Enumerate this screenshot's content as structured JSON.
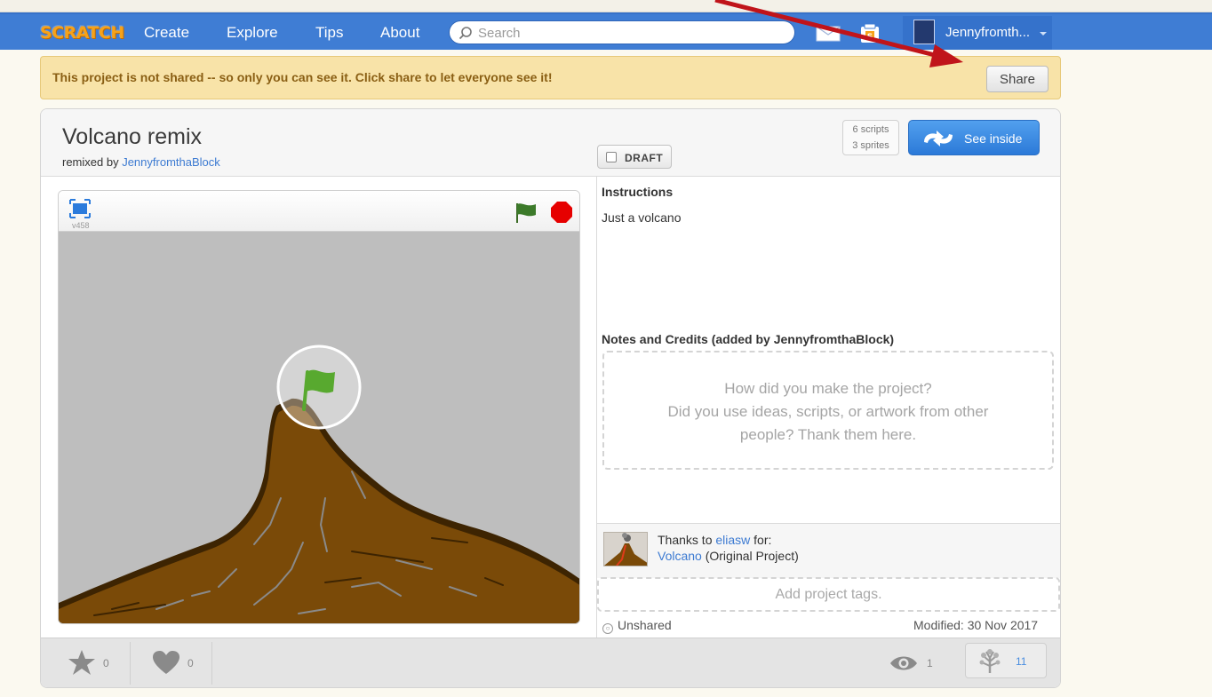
{
  "nav": {
    "logo": "SCRATCH",
    "items": [
      {
        "label": "Create"
      },
      {
        "label": "Explore"
      },
      {
        "label": "Tips"
      },
      {
        "label": "About"
      }
    ],
    "search_placeholder": "Search",
    "username": "Jennyfromth...",
    "icons": [
      "messages-icon",
      "my-stuff-icon",
      "avatar"
    ]
  },
  "banner": {
    "text": "This project is not shared -- so only you can see it. Click share to let everyone see it!",
    "share_label": "Share"
  },
  "project": {
    "title": "Volcano remix",
    "remixed_by_prefix": "remixed by ",
    "author": "JennyfromthaBlock",
    "draft_label": "DRAFT",
    "scripts": "6 scripts",
    "sprites": "3 sprites",
    "see_inside_label": "See inside",
    "version": "v458"
  },
  "instructions": {
    "title": "Instructions",
    "text": "Just a volcano"
  },
  "notes": {
    "title": "Notes and Credits (added by JennyfromthaBlock)",
    "placeholder_line1": "How did you make the project?",
    "placeholder_line2": "Did you use ideas, scripts, or artwork from other",
    "placeholder_line3": "people? Thank them here."
  },
  "credits": {
    "thanks_prefix": "Thanks to ",
    "user": "eliasw",
    "thanks_suffix": " for:",
    "project": "Volcano",
    "project_suffix": " (Original Project)"
  },
  "tags": {
    "placeholder": "Add project tags."
  },
  "status": {
    "shared": "Unshared",
    "modified": "Modified: 30 Nov 2017"
  },
  "stats": {
    "favorites": "0",
    "loves": "0",
    "views": "1",
    "remixes": "11"
  },
  "colors": {
    "navbar": "#3f7dd4",
    "banner": "#f8e3a8",
    "link": "#3d7bd2",
    "volcano": "#7a4a08",
    "annotation_arrow": "#c0141a"
  }
}
